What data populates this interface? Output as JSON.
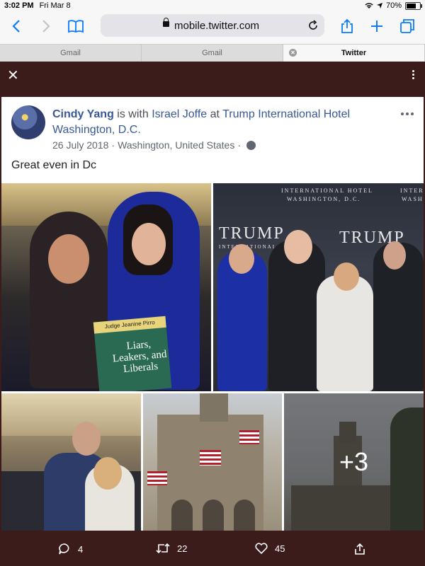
{
  "status_bar": {
    "time": "3:02 PM",
    "date": "Fri Mar 8",
    "battery": "70%",
    "battery_level": 0.7
  },
  "browser": {
    "url": "mobile.twitter.com"
  },
  "tabs": [
    {
      "label": "Gmail"
    },
    {
      "label": "Gmail"
    },
    {
      "label": "Twitter",
      "active": true
    }
  ],
  "post": {
    "author": "Cindy Yang",
    "with_text": "is with",
    "tagged": "Israel Joffe",
    "at_text": "at",
    "place": "Trump International Hotel Washington, D.C.",
    "date": "26 July 2018",
    "location": "Washington, United States",
    "separator": "·",
    "text": "Great even in Dc",
    "more_photos": "+3",
    "photo1": {
      "book_author": "Judge Jeanine Pirro",
      "book_title": "Liars, Leakers, and Liberals"
    },
    "photo2": {
      "sign_top": "INTERNATIONAL HOTEL",
      "sign_city": "WASHINGTON, D.C.",
      "brand": "TRUMP",
      "brand2": "TRUMP",
      "sign_sub": "INTERNATIONAL",
      "sign_right": "INTERNA",
      "sign_right2": "WASHI"
    }
  },
  "actions": {
    "replies": "4",
    "retweets": "22",
    "likes": "45"
  }
}
